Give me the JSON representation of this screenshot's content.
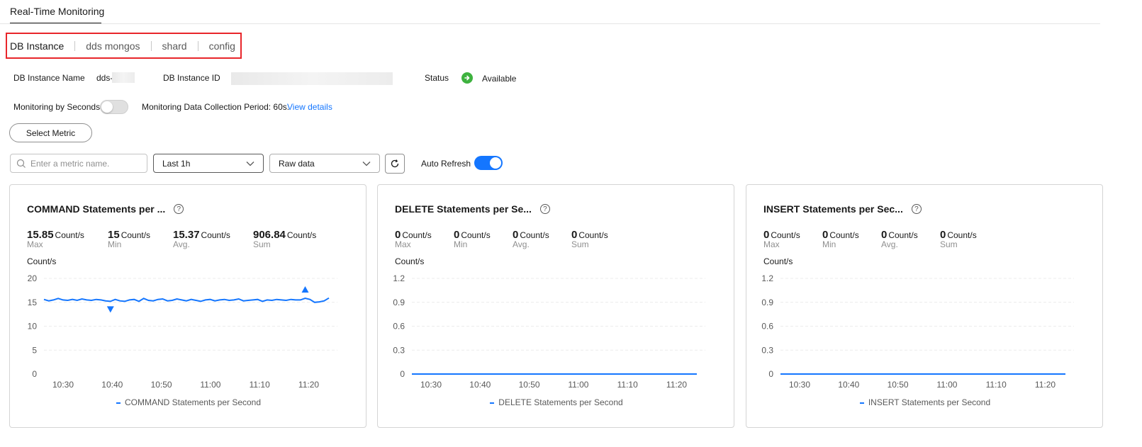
{
  "page": {
    "tab": "Real-Time Monitoring"
  },
  "sub_tabs": [
    "DB Instance",
    "dds mongos",
    "shard",
    "config"
  ],
  "instance": {
    "name_label": "DB Instance Name",
    "name_value": "dds-",
    "id_label": "DB Instance ID",
    "status_label": "Status",
    "status_value": "Available",
    "status_color": "#3eb23f"
  },
  "monitoring": {
    "by_seconds_label": "Monitoring by Seconds",
    "by_seconds_enabled": false,
    "period_text": "Monitoring Data Collection Period: 60s.",
    "view_details": "View details"
  },
  "toolbar": {
    "select_metric": "Select Metric",
    "search_placeholder": "Enter a metric name.",
    "time_range": "Last 1h",
    "data_type": "Raw data",
    "auto_refresh_label": "Auto Refresh",
    "auto_refresh_enabled": true
  },
  "colors": {
    "accent": "#1476ff",
    "highlight_border": "#e8262b"
  },
  "chart_data": [
    {
      "type": "line",
      "title": "COMMAND Statements per ...",
      "stats": [
        {
          "value": "15.85",
          "unit": "Count/s",
          "label": "Max"
        },
        {
          "value": "15",
          "unit": "Count/s",
          "label": "Min"
        },
        {
          "value": "15.37",
          "unit": "Count/s",
          "label": "Avg."
        },
        {
          "value": "906.84",
          "unit": "Count/s",
          "label": "Sum"
        }
      ],
      "ylabel": "Count/s",
      "yticks": [
        "20",
        "15",
        "10",
        "5",
        "0"
      ],
      "ylim": [
        0,
        20
      ],
      "xticks": [
        "10:30",
        "10:40",
        "10:50",
        "11:00",
        "11:10",
        "11:20"
      ],
      "series": [
        {
          "name": "COMMAND Statements per Second",
          "values": [
            15.6,
            15.3,
            15.5,
            15.8,
            15.5,
            15.4,
            15.6,
            15.4,
            15.7,
            15.5,
            15.4,
            15.6,
            15.5,
            15.3,
            15.2,
            15.6,
            15.3,
            15.2,
            15.5,
            15.6,
            15.2,
            15.8,
            15.4,
            15.3,
            15.6,
            15.7,
            15.3,
            15.4,
            15.7,
            15.5,
            15.3,
            15.6,
            15.4,
            15.2,
            15.5,
            15.6,
            15.3,
            15.5,
            15.6,
            15.4,
            15.5,
            15.7,
            15.3,
            15.4,
            15.5,
            15.6,
            15.2,
            15.5,
            15.4,
            15.6,
            15.5,
            15.4,
            15.6,
            15.5,
            15.5,
            15.85,
            15.6,
            15.0,
            15.1,
            15.3,
            15.9
          ],
          "min_marker_index": 14,
          "max_marker_index": 55
        }
      ]
    },
    {
      "type": "line",
      "title": "DELETE Statements per Se...",
      "stats": [
        {
          "value": "0",
          "unit": "Count/s",
          "label": "Max"
        },
        {
          "value": "0",
          "unit": "Count/s",
          "label": "Min"
        },
        {
          "value": "0",
          "unit": "Count/s",
          "label": "Avg."
        },
        {
          "value": "0",
          "unit": "Count/s",
          "label": "Sum"
        }
      ],
      "ylabel": "Count/s",
      "yticks": [
        "1.2",
        "0.9",
        "0.6",
        "0.3",
        "0"
      ],
      "ylim": [
        0,
        1.2
      ],
      "xticks": [
        "10:30",
        "10:40",
        "10:50",
        "11:00",
        "11:10",
        "11:20"
      ],
      "series": [
        {
          "name": "DELETE Statements per Second",
          "values": [
            0,
            0,
            0,
            0,
            0,
            0,
            0,
            0,
            0,
            0
          ]
        }
      ]
    },
    {
      "type": "line",
      "title": "INSERT Statements per Sec...",
      "stats": [
        {
          "value": "0",
          "unit": "Count/s",
          "label": "Max"
        },
        {
          "value": "0",
          "unit": "Count/s",
          "label": "Min"
        },
        {
          "value": "0",
          "unit": "Count/s",
          "label": "Avg."
        },
        {
          "value": "0",
          "unit": "Count/s",
          "label": "Sum"
        }
      ],
      "ylabel": "Count/s",
      "yticks": [
        "1.2",
        "0.9",
        "0.6",
        "0.3",
        "0"
      ],
      "ylim": [
        0,
        1.2
      ],
      "xticks": [
        "10:30",
        "10:40",
        "10:50",
        "11:00",
        "11:10",
        "11:20"
      ],
      "series": [
        {
          "name": "INSERT Statements per Second",
          "values": [
            0,
            0,
            0,
            0,
            0,
            0,
            0,
            0,
            0,
            0
          ]
        }
      ]
    }
  ]
}
